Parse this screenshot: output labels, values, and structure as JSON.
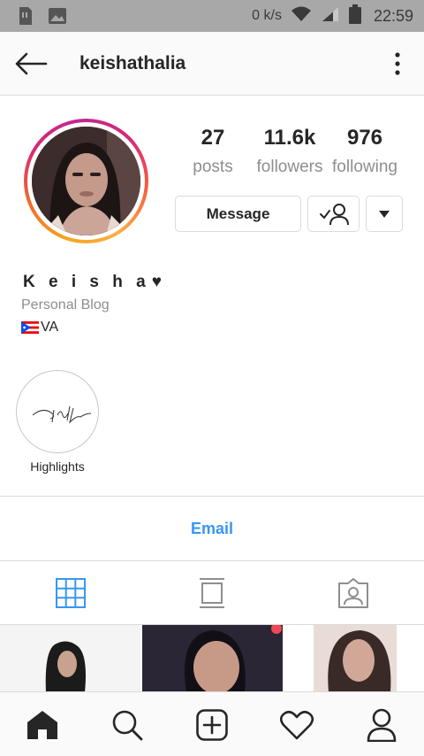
{
  "status_bar": {
    "network_speed": "0 k/s",
    "time": "22:59",
    "icons": [
      "sim-card-icon",
      "image-icon",
      "wifi-icon",
      "signal-icon",
      "battery-icon"
    ]
  },
  "header": {
    "username": "keishathalia",
    "back_icon": "arrow-left-icon",
    "more_icon": "more-vertical-icon"
  },
  "profile": {
    "stats": [
      {
        "value": "27",
        "label": "posts"
      },
      {
        "value": "11.6k",
        "label": "followers"
      },
      {
        "value": "976",
        "label": "following"
      }
    ],
    "buttons": {
      "message_label": "Message",
      "following_icon": "following-check-icon",
      "dropdown_icon": "caret-down-icon"
    },
    "story_ring_colors": [
      "#f7a41d",
      "#f2672a",
      "#d62976",
      "#c1288e"
    ]
  },
  "bio": {
    "name": "K e i s h a",
    "name_emoji_icon": "black-heart-icon",
    "category": "Personal Blog",
    "location_flag_icon": "puerto-rico-flag-icon",
    "location": "VA"
  },
  "highlights": [
    {
      "label": "Highlights",
      "cover_text": "faith"
    }
  ],
  "contact": {
    "email_label": "Email",
    "accent": "#3897f0"
  },
  "tabs": [
    {
      "icon": "grid-icon",
      "active": true
    },
    {
      "icon": "igtv-icon",
      "active": false
    },
    {
      "icon": "tagged-icon",
      "active": false
    }
  ],
  "bottom_nav": [
    {
      "icon": "home-icon",
      "active": true
    },
    {
      "icon": "search-icon",
      "active": false
    },
    {
      "icon": "add-post-icon",
      "active": false
    },
    {
      "icon": "heart-icon",
      "active": false
    },
    {
      "icon": "profile-icon",
      "active": false
    }
  ]
}
